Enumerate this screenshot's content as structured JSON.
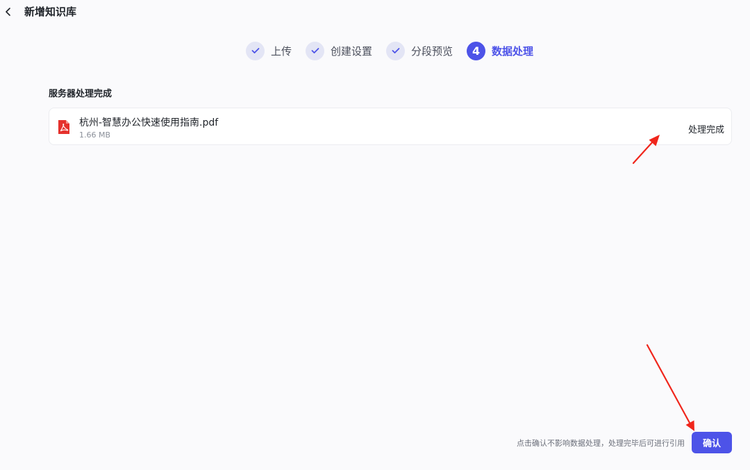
{
  "header": {
    "back_icon": "chevron-left-icon",
    "title": "新增知识库"
  },
  "steps": [
    {
      "label": "上传",
      "state": "done",
      "icon": "check-icon"
    },
    {
      "label": "创建设置",
      "state": "done",
      "icon": "check-icon"
    },
    {
      "label": "分段预览",
      "state": "done",
      "icon": "check-icon"
    },
    {
      "label": "数据处理",
      "state": "active",
      "number": "4"
    }
  ],
  "section": {
    "title": "服务器处理完成",
    "files": [
      {
        "icon": "pdf-icon",
        "name": "杭州-智慧办公快速使用指南.pdf",
        "size": "1.66 MB",
        "status": "处理完成"
      }
    ]
  },
  "footer": {
    "hint": "点击确认不影响数据处理，处理完毕后可进行引用",
    "confirm_label": "确认"
  },
  "colors": {
    "accent": "#4d53e8",
    "step_done_bg": "#e3e5f5",
    "pdf_red": "#e5322d",
    "annotation_arrow": "#f0261c"
  }
}
